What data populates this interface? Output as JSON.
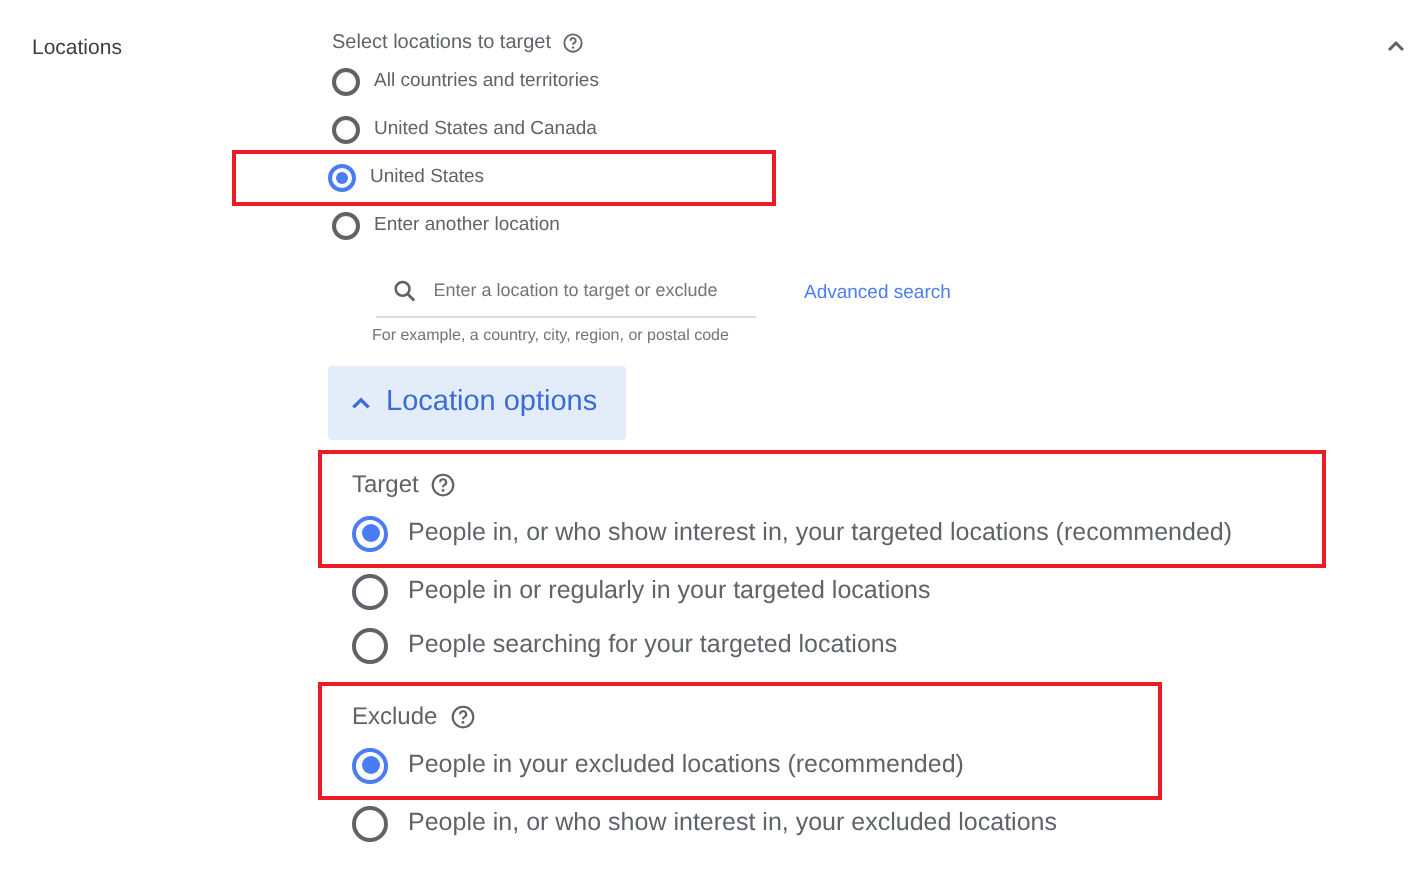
{
  "section": {
    "title": "Locations",
    "expanded": true
  },
  "select": {
    "label": "Select locations to target",
    "options": [
      {
        "label": "All countries and territories",
        "selected": false,
        "highlighted": false
      },
      {
        "label": "United States and Canada",
        "selected": false,
        "highlighted": false
      },
      {
        "label": "United States",
        "selected": true,
        "highlighted": true
      },
      {
        "label": "Enter another location",
        "selected": false,
        "highlighted": false
      }
    ]
  },
  "search": {
    "placeholder": "Enter a location to target or exclude",
    "link": "Advanced search",
    "hint": "For example, a country, city, region, or postal code"
  },
  "location_options": {
    "label": "Location options",
    "expanded": true
  },
  "groups": [
    {
      "label": "Target",
      "highlighted": true,
      "options": [
        {
          "label": "People in, or who show interest in, your targeted locations (recommended)",
          "selected": true,
          "highlighted": true
        },
        {
          "label": "People in or regularly in your targeted locations",
          "selected": false,
          "highlighted": false
        },
        {
          "label": "People searching for your targeted locations",
          "selected": false,
          "highlighted": false
        }
      ]
    },
    {
      "label": "Exclude",
      "highlighted": true,
      "options": [
        {
          "label": "People in your excluded locations (recommended)",
          "selected": true,
          "highlighted": true
        },
        {
          "label": "People in, or who show interest in, your excluded locations",
          "selected": false,
          "highlighted": false
        }
      ]
    }
  ]
}
